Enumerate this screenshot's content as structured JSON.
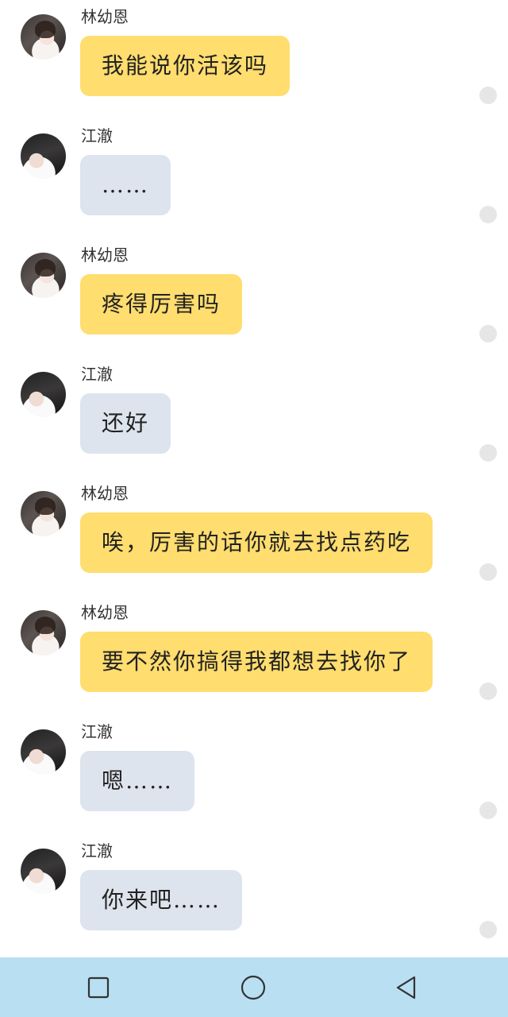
{
  "chat": {
    "messages": [
      {
        "sender": "林幼恩",
        "text": "我能说你活该吗",
        "side": "her",
        "bubble_color": "#ffdd6e"
      },
      {
        "sender": "江澈",
        "text": "……",
        "side": "him",
        "bubble_color": "#dde4ed"
      },
      {
        "sender": "林幼恩",
        "text": "疼得厉害吗",
        "side": "her",
        "bubble_color": "#ffdd6e"
      },
      {
        "sender": "江澈",
        "text": "还好",
        "side": "him",
        "bubble_color": "#dde4ed"
      },
      {
        "sender": "林幼恩",
        "text": "唉，厉害的话你就去找点药吃",
        "side": "her",
        "bubble_color": "#ffdd6e"
      },
      {
        "sender": "林幼恩",
        "text": "要不然你搞得我都想去找你了",
        "side": "her",
        "bubble_color": "#ffdd6e"
      },
      {
        "sender": "江澈",
        "text": "嗯……",
        "side": "him",
        "bubble_color": "#dde4ed"
      },
      {
        "sender": "江澈",
        "text": "你来吧……",
        "side": "him",
        "bubble_color": "#dde4ed"
      }
    ]
  },
  "navbar": {
    "background": "#b8dff2",
    "buttons": [
      {
        "icon": "square-recents-icon"
      },
      {
        "icon": "circle-home-icon"
      },
      {
        "icon": "triangle-back-icon"
      }
    ]
  }
}
